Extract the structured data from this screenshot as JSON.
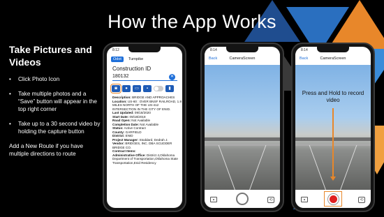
{
  "slide": {
    "title": "How the App Works",
    "colors": {
      "accent_orange": "#e8872a",
      "app_blue": "#1e6fd9",
      "record_red": "#e02020"
    }
  },
  "left_panel": {
    "heading": "Take Pictures and Videos",
    "bullets": [
      "Click Photo Icon",
      "Take multiple photos and a “Save” button will appear in the top right corner",
      "Take up to a 30 second video by holding the capture button"
    ],
    "note": "Add a New Route if you have multiple directions to route"
  },
  "phone1": {
    "time": "8:12",
    "tabs": [
      "Odot",
      "Turnpike"
    ],
    "field_label": "Construction ID",
    "field_value": "180132",
    "icons": [
      "camera-icon",
      "location-icon",
      "message-icon",
      "image-icon",
      "toggle-icon",
      "book-icon"
    ],
    "details": [
      {
        "label": "Description:",
        "value": "BRIDGE AND APPROACHES"
      },
      {
        "label": "Location:",
        "value": "US-60 : OVER BNSF RAILROAD, 1.8 MILES NORTH OF THE US-412 INTERSECTION IN THE CITY OF ENID."
      },
      {
        "label": "Last Updated:",
        "value": "09/18/2020"
      },
      {
        "label": "Start Date:",
        "value": "09/18/2018"
      },
      {
        "label": "Road Open:",
        "value": "Not Available"
      },
      {
        "label": "Completion Date:",
        "value": "Not Available"
      },
      {
        "label": "Status:",
        "value": "Active Contract"
      },
      {
        "label": "County:",
        "value": "GARFIELD"
      },
      {
        "label": "District:",
        "value": "ENID"
      },
      {
        "label": "Project Manager:",
        "value": "Stoddard, Dedrah J."
      },
      {
        "label": "Vendor:",
        "value": "BRIDGES, INC. DBA SCUDDER BRIDGE CO."
      },
      {
        "label": "Contract Items:",
        "value": ""
      },
      {
        "label": "Administrative Office:",
        "value": "District 4,Oklahoma Department of Transportation,Oklahoma State Transportation,Enid Residency"
      }
    ]
  },
  "phone2": {
    "time": "8:14",
    "back": "Back",
    "title": "CameraScreen"
  },
  "phone3": {
    "time": "8:14",
    "back": "Back",
    "title": "CameraScreen",
    "callout": "Press and Hold to record video"
  }
}
